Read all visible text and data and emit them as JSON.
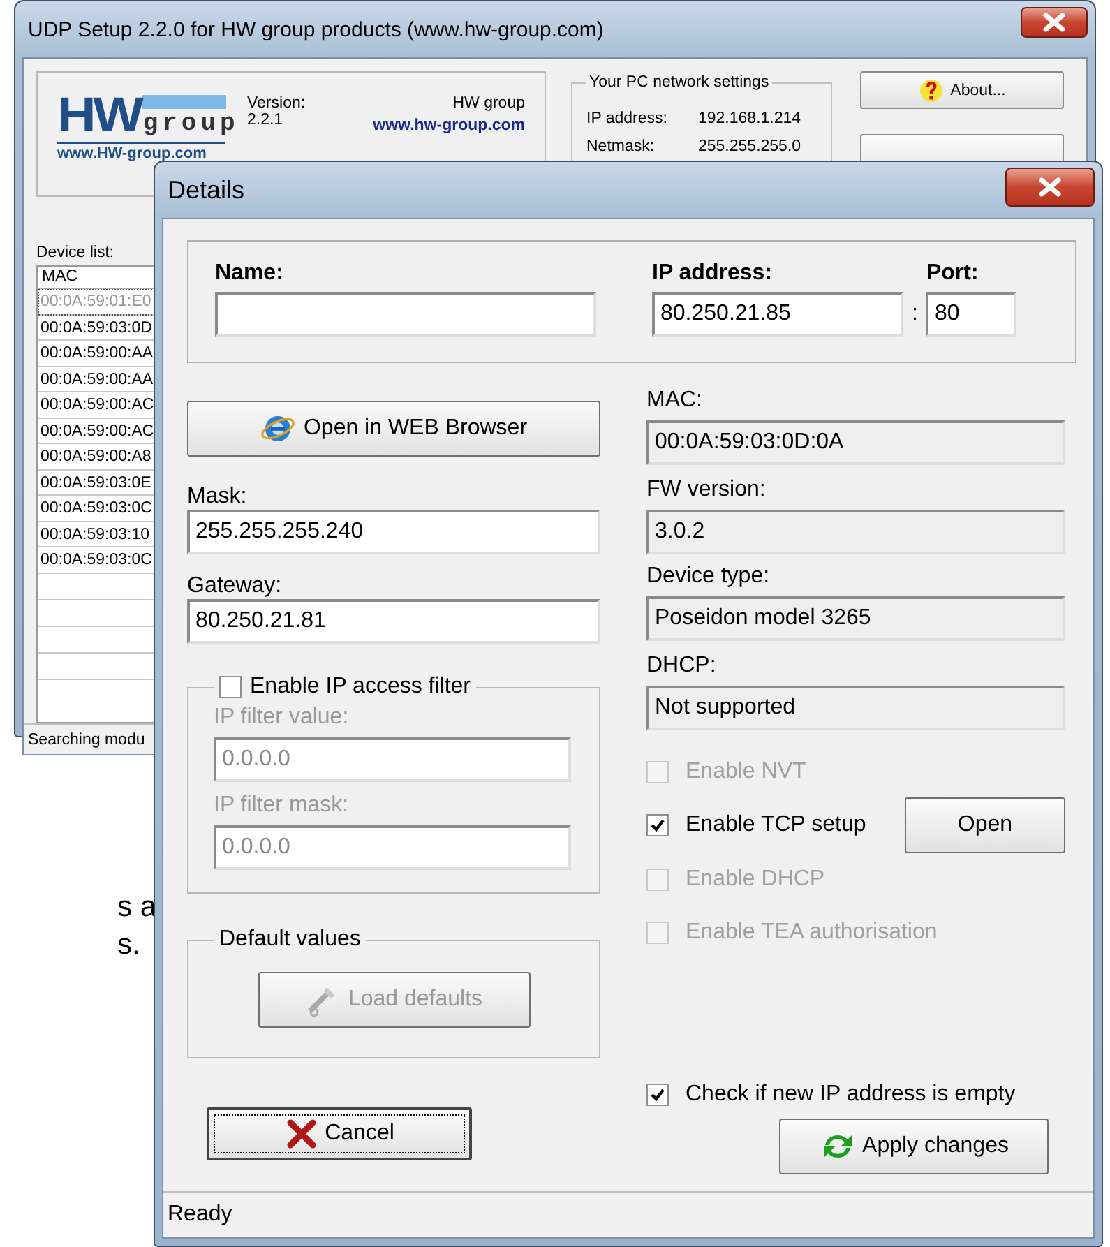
{
  "main_window": {
    "title": "UDP Setup 2.2.0 for HW group products (www.hw-group.com)",
    "logo": {
      "mark": "HW",
      "word": "group",
      "url": "www.HW-group.com"
    },
    "version_label": "Version:",
    "version": "2.2.1",
    "company": "HW group",
    "company_link": "www.hw-group.com",
    "pc_network": {
      "title": "Your PC network settings",
      "rows": [
        {
          "label": "IP address:",
          "value": "192.168.1.214"
        },
        {
          "label": "Netmask:",
          "value": "255.255.255.0"
        }
      ]
    },
    "about_button": "About...",
    "device_list": {
      "label": "Device list:",
      "column": "MAC",
      "rows": [
        {
          "mac": "00:0A:59:01:E0",
          "selected": true
        },
        {
          "mac": "00:0A:59:03:0D",
          "selected": false
        },
        {
          "mac": "00:0A:59:00:AA",
          "selected": false
        },
        {
          "mac": "00:0A:59:00:AA",
          "selected": false
        },
        {
          "mac": "00:0A:59:00:AC",
          "selected": false
        },
        {
          "mac": "00:0A:59:00:AC",
          "selected": false
        },
        {
          "mac": "00:0A:59:00:A8",
          "selected": false
        },
        {
          "mac": "00:0A:59:03:0E",
          "selected": false
        },
        {
          "mac": "00:0A:59:03:0C",
          "selected": false
        },
        {
          "mac": "00:0A:59:03:10",
          "selected": false
        },
        {
          "mac": "00:0A:59:03:0C",
          "selected": false
        }
      ]
    },
    "status_bar": "Searching modu"
  },
  "background_text": [
    "s a",
    "s."
  ],
  "details": {
    "title": "Details",
    "name": {
      "label": "Name:"
    },
    "ip": {
      "label": "IP address:",
      "value": "80.250.21.85"
    },
    "separator": ":",
    "port": {
      "label": "Port:",
      "value": "80"
    },
    "browser_button": "Open in WEB Browser",
    "left_fields": [
      {
        "label": "Mask:",
        "value": "255.255.255.240"
      },
      {
        "label": "Gateway:",
        "value": "80.250.21.81"
      }
    ],
    "ip_filter": {
      "label": "Enable IP access filter",
      "checked": false,
      "fields": [
        {
          "label": "IP filter value:",
          "value": "0.0.0.0",
          "disabled": true
        },
        {
          "label": "IP filter mask:",
          "value": "0.0.0.0",
          "disabled": true
        }
      ]
    },
    "defaults": {
      "title": "Default values",
      "button": "Load defaults",
      "disabled": true
    },
    "cancel_button": "Cancel",
    "info_fields": [
      {
        "label": "MAC:",
        "value": "00:0A:59:03:0D:0A",
        "readonly": true
      },
      {
        "label": "FW version:",
        "value": "3.0.2",
        "readonly": true
      },
      {
        "label": "Device type:",
        "value": "Poseidon model 3265",
        "readonly": true
      },
      {
        "label": "DHCP:",
        "value": "Not supported",
        "readonly": true
      }
    ],
    "options": [
      {
        "label": "Enable NVT",
        "checked": false,
        "disabled": true
      },
      {
        "label": "Enable TCP setup",
        "checked": true,
        "disabled": false,
        "button": "Open"
      },
      {
        "label": "Enable DHCP",
        "checked": false,
        "disabled": true
      },
      {
        "label": "Enable TEA authorisation",
        "checked": false,
        "disabled": true
      }
    ],
    "check_empty": {
      "label": "Check if new IP address is empty",
      "checked": true,
      "disabled": false
    },
    "apply_button": "Apply changes",
    "status_bar": "Ready"
  }
}
